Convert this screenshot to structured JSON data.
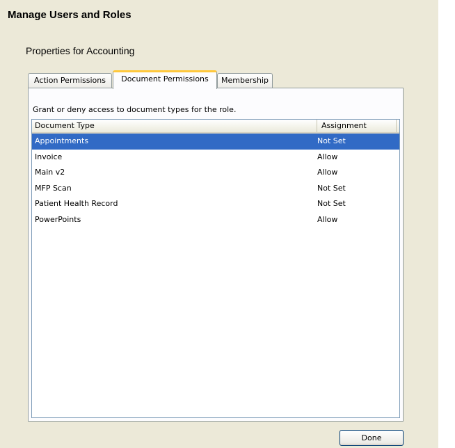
{
  "header": {
    "title": "Manage Users and Roles"
  },
  "properties": {
    "subtitle": "Properties for Accounting"
  },
  "tabs": [
    {
      "label": "Action Permissions",
      "active": false
    },
    {
      "label": "Document Permissions",
      "active": true
    },
    {
      "label": "Membership",
      "active": false
    }
  ],
  "document_permissions": {
    "instruction": "Grant or deny access to document types for the role.",
    "columns": {
      "type": "Document Type",
      "assignment": "Assignment"
    },
    "rows": [
      {
        "type": "Appointments",
        "assignment": "Not Set",
        "selected": true
      },
      {
        "type": "Invoice",
        "assignment": "Allow",
        "selected": false
      },
      {
        "type": "Main v2",
        "assignment": "Allow",
        "selected": false
      },
      {
        "type": "MFP Scan",
        "assignment": "Not Set",
        "selected": false
      },
      {
        "type": "Patient Health Record",
        "assignment": "Not Set",
        "selected": false
      },
      {
        "type": "PowerPoints",
        "assignment": "Allow",
        "selected": false
      }
    ]
  },
  "footer": {
    "done_label": "Done"
  },
  "colors": {
    "panel_background": "#ece9d8",
    "selection": "#316ac5",
    "active_tab_accent": "#ffc83c"
  }
}
